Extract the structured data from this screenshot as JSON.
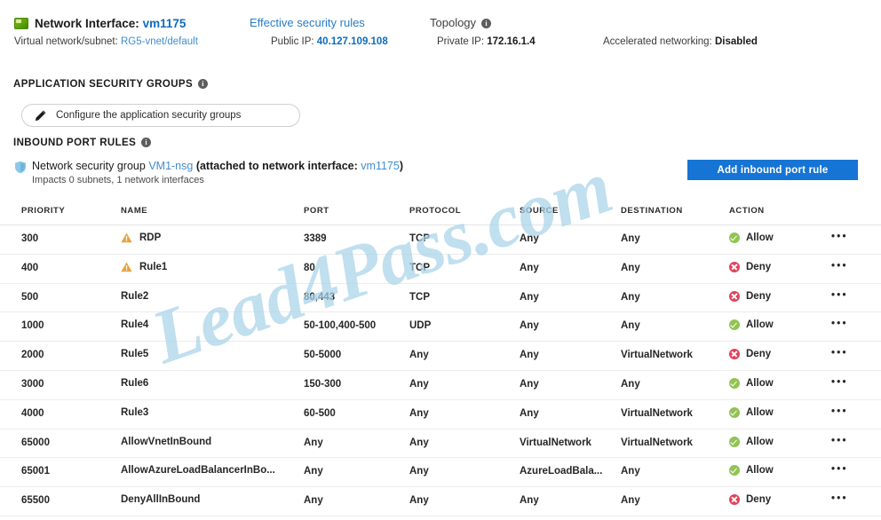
{
  "header": {
    "nic_icon": "network-interface-icon",
    "title_label": "Network Interface:",
    "title_value": "vm1175",
    "links": [
      {
        "label": "Effective security rules",
        "name": "effective-security-rules"
      },
      {
        "label": "Topology",
        "name": "topology"
      }
    ],
    "fields": [
      {
        "label": "Virtual network/subnet:",
        "value": "RG5-vnet/default",
        "style": "link"
      },
      {
        "label": "Public IP:",
        "value": "40.127.109.108",
        "style": "boldblue"
      },
      {
        "label": "Private IP:",
        "value": "172.16.1.4",
        "style": "bold"
      },
      {
        "label": "Accelerated networking:",
        "value": "Disabled",
        "style": "bold"
      }
    ]
  },
  "application_security_groups": {
    "section_title": "APPLICATION SECURITY GROUPS",
    "configure_button_label": "Configure the application security groups",
    "pencil_icon": "pencil-icon",
    "info_icon": "info-icon"
  },
  "inbound_port_rules": {
    "section_title": "INBOUND PORT RULES",
    "info_icon": "info-icon",
    "nsg_shield_icon": "shield-icon",
    "nsg_prefix": "Network security group ",
    "nsg_name": "VM1-nsg",
    "nsg_attached_prefix": " (attached to network interface: ",
    "nsg_attached_nic": "vm1175",
    "nsg_attached_suffix": ")",
    "nsg_impacts": "Impacts 0 subnets, 1 network interfaces",
    "add_button_label": "Add inbound port rule",
    "add_button_color": "#1674d4"
  },
  "table": {
    "columns": [
      "PRIORITY",
      "NAME",
      "PORT",
      "PROTOCOL",
      "SOURCE",
      "DESTINATION",
      "ACTION"
    ],
    "rows": [
      {
        "priority": "300",
        "name": "RDP",
        "warning": true,
        "port": "3389",
        "protocol": "TCP",
        "source": "Any",
        "destination": "Any",
        "action": "Allow",
        "menu": "•••"
      },
      {
        "priority": "400",
        "name": "Rule1",
        "warning": true,
        "port": "80",
        "protocol": "TCP",
        "source": "Any",
        "destination": "Any",
        "action": "Deny",
        "menu": "•••"
      },
      {
        "priority": "500",
        "name": "Rule2",
        "warning": false,
        "port": "80,443",
        "protocol": "TCP",
        "source": "Any",
        "destination": "Any",
        "action": "Deny",
        "menu": "•••"
      },
      {
        "priority": "1000",
        "name": "Rule4",
        "warning": false,
        "port": "50-100,400-500",
        "protocol": "UDP",
        "source": "Any",
        "destination": "Any",
        "action": "Allow",
        "menu": "•••"
      },
      {
        "priority": "2000",
        "name": "Rule5",
        "warning": false,
        "port": "50-5000",
        "protocol": "Any",
        "source": "Any",
        "destination": "VirtualNetwork",
        "action": "Deny",
        "menu": "•••"
      },
      {
        "priority": "3000",
        "name": "Rule6",
        "warning": false,
        "port": "150-300",
        "protocol": "Any",
        "source": "Any",
        "destination": "Any",
        "action": "Allow",
        "menu": "•••"
      },
      {
        "priority": "4000",
        "name": "Rule3",
        "warning": false,
        "port": "60-500",
        "protocol": "Any",
        "source": "Any",
        "destination": "VirtualNetwork",
        "action": "Allow",
        "menu": "•••"
      },
      {
        "priority": "65000",
        "name": "AllowVnetInBound",
        "warning": false,
        "port": "Any",
        "protocol": "Any",
        "source": "VirtualNetwork",
        "destination": "VirtualNetwork",
        "action": "Allow",
        "menu": "•••"
      },
      {
        "priority": "65001",
        "name": "AllowAzureLoadBalancerInBo...",
        "warning": false,
        "port": "Any",
        "protocol": "Any",
        "source": "AzureLoadBala...",
        "destination": "Any",
        "action": "Allow",
        "menu": "•••"
      },
      {
        "priority": "65500",
        "name": "DenyAllInBound",
        "warning": false,
        "port": "Any",
        "protocol": "Any",
        "source": "Any",
        "destination": "Any",
        "action": "Deny",
        "menu": "•••"
      }
    ]
  },
  "watermark": {
    "text": "Lead4Pass.com",
    "color": "#a8d4ea"
  },
  "colors": {
    "link_blue": "#3f8dd0",
    "accent_blue": "#0f6cbd",
    "button_blue": "#1674d4",
    "allow_green": "#92c353",
    "deny_red": "#e0425a",
    "warning_orange": "#e8a33d"
  }
}
